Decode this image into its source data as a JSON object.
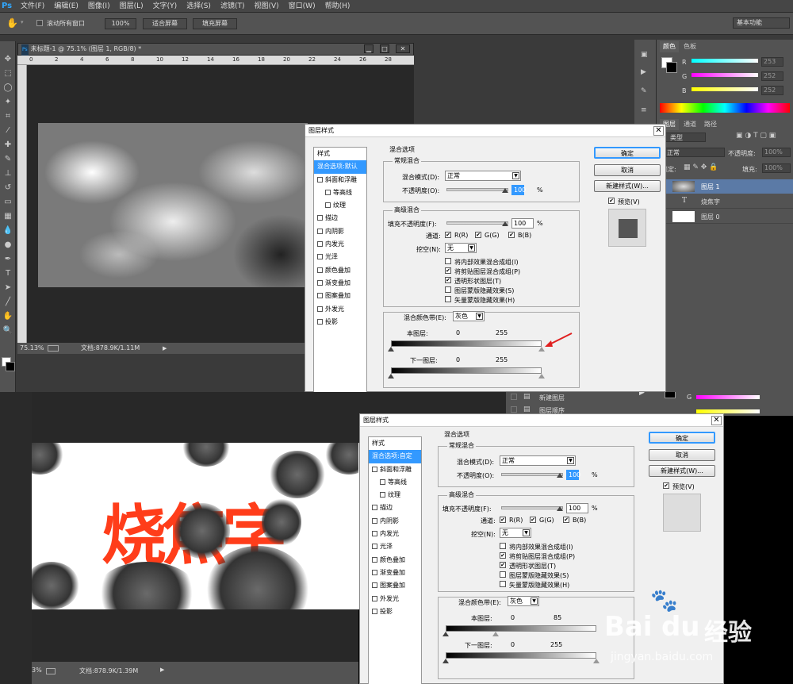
{
  "app": {
    "logo": "Ps"
  },
  "menu": [
    "文件(F)",
    "编辑(E)",
    "图像(I)",
    "图层(L)",
    "文字(Y)",
    "选择(S)",
    "滤镜(T)",
    "视图(V)",
    "窗口(W)",
    "帮助(H)"
  ],
  "options": {
    "scroll_all": "滚动所有窗口",
    "zoom": "100%",
    "fit": "适合屏幕",
    "fill": "填充屏幕",
    "workspace": "基本功能"
  },
  "document": {
    "title": "未标题-1 @ 75.1% (图层 1, RGB/8) *",
    "ruler_ticks": [
      "0",
      "2",
      "4",
      "6",
      "8",
      "10",
      "12",
      "14",
      "16",
      "18",
      "20",
      "22",
      "24",
      "26",
      "28"
    ],
    "zoom_status": "75.13%",
    "doc_status": "文档:878.9K/1.11M"
  },
  "color_panel": {
    "tabs": [
      "颜色",
      "色板"
    ],
    "channels": [
      {
        "name": "R",
        "value": "253"
      },
      {
        "name": "G",
        "value": "252"
      },
      {
        "name": "B",
        "value": "252"
      }
    ]
  },
  "layers_panel": {
    "tabs": [
      "图层",
      "通道",
      "路径"
    ],
    "kind": "类型",
    "mode": "正常",
    "opacity_label": "不透明度:",
    "opacity": "100%",
    "lock_label": "锁定:",
    "fill_label": "填充:",
    "fill": "100%",
    "layers": [
      {
        "name": "图层 1",
        "icon": "cloud-thumb"
      },
      {
        "name": "烧焦字",
        "icon": "text-T"
      },
      {
        "name": "图层 0",
        "icon": "white-thumb"
      }
    ]
  },
  "dialog1": {
    "title": "图层样式",
    "styles_header": "样式",
    "styles": [
      "混合选项:默认",
      "斜面和浮雕",
      "等高线",
      "纹理",
      "描边",
      "内阴影",
      "内发光",
      "光泽",
      "颜色叠加",
      "渐变叠加",
      "图案叠加",
      "外发光",
      "投影"
    ],
    "blend_section": "混合选项",
    "general": "常规混合",
    "mode_label": "混合模式(D):",
    "mode": "正常",
    "opacity_label": "不透明度(O):",
    "opacity": "100",
    "pct": "%",
    "advanced": "高级混合",
    "fill_label": "填充不透明度(F):",
    "fill": "100",
    "channels_label": "通道:",
    "r": "R(R)",
    "g": "G(G)",
    "b": "B(B)",
    "knockout_label": "挖空(N):",
    "knockout": "无",
    "opts": [
      "将内部效果混合成组(I)",
      "将剪贴图层混合成组(P)",
      "透明形状图层(T)",
      "图层蒙版隐藏效果(S)",
      "矢量蒙版隐藏效果(H)"
    ],
    "opts_checked": [
      false,
      true,
      true,
      false,
      false
    ],
    "band_label": "混合颜色带(E):",
    "band": "灰色",
    "this_layer": "本图层:",
    "this_vals": [
      "0",
      "255"
    ],
    "under_layer": "下一图层:",
    "under_vals": [
      "0",
      "255"
    ],
    "buttons": [
      "确定",
      "取消",
      "新建样式(W)..."
    ],
    "preview": "预览(V)"
  },
  "partial_layers": [
    "新建图层",
    "图层顺序"
  ],
  "dialog2": {
    "title": "图层样式",
    "styles_header": "样式",
    "styles": [
      "混合选项:自定",
      "斜面和浮雕",
      "等高线",
      "纹理",
      "描边",
      "内阴影",
      "内发光",
      "光泽",
      "颜色叠加",
      "渐变叠加",
      "图案叠加",
      "外发光",
      "投影"
    ],
    "blend_section": "混合选项",
    "general": "常规混合",
    "mode_label": "混合模式(D):",
    "mode": "正常",
    "opacity_label": "不透明度(O):",
    "opacity": "100",
    "pct": "%",
    "advanced": "高级混合",
    "fill_label": "填充不透明度(F):",
    "fill": "100",
    "channels_label": "通道:",
    "r": "R(R)",
    "g": "G(G)",
    "b": "B(B)",
    "knockout_label": "挖空(N):",
    "knockout": "无",
    "opts": [
      "将内部效果混合成组(I)",
      "将剪贴图层混合成组(P)",
      "透明形状图层(T)",
      "图层蒙版隐藏效果(S)",
      "矢量蒙版隐藏效果(H)"
    ],
    "opts_checked": [
      false,
      true,
      true,
      false,
      false
    ],
    "band_label": "混合颜色带(E):",
    "band": "灰色",
    "this_layer": "本图层:",
    "this_vals": [
      "0",
      "85"
    ],
    "under_layer": "下一图层:",
    "under_vals": [
      "0",
      "255"
    ],
    "buttons": [
      "确定",
      "取消",
      "新建样式(W)..."
    ],
    "preview": "预览(V)"
  },
  "artwork": {
    "text": "烧焦字",
    "color": "#ff3d1a"
  },
  "status2": {
    "zoom": "3%",
    "doc": "文档:878.9K/1.39M"
  },
  "watermark": {
    "brand": "Bai",
    "brand2": "du",
    "label": "经验",
    "url": "jingyan.baidu.com"
  }
}
